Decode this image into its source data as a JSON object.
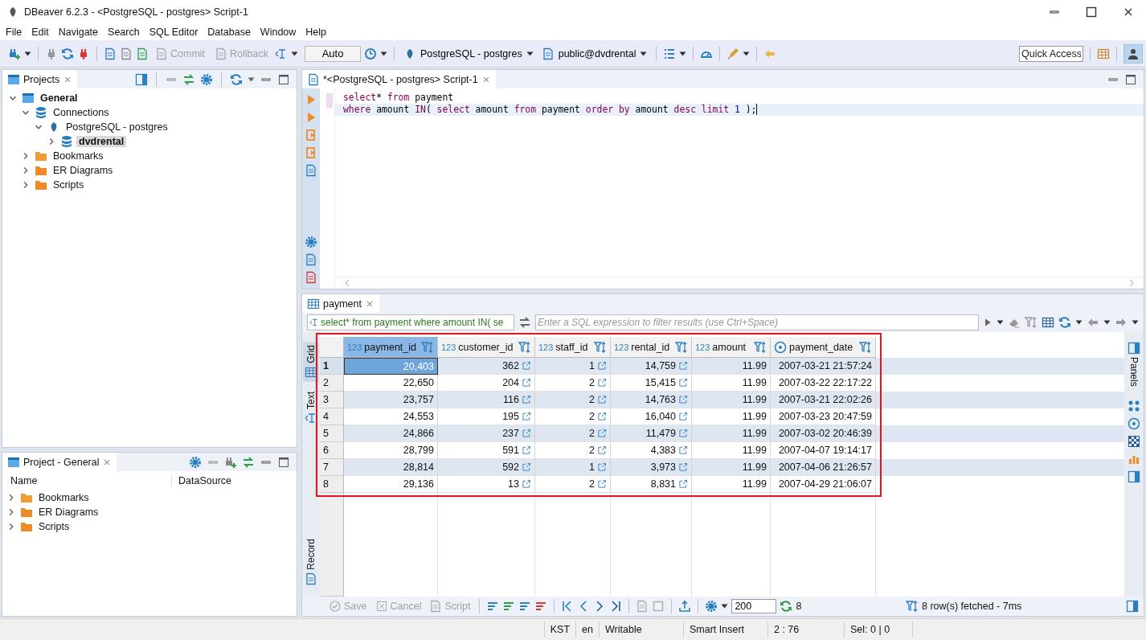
{
  "window": {
    "title": "DBeaver 6.2.3 - <PostgreSQL - postgres> Script-1"
  },
  "menu": [
    "File",
    "Edit",
    "Navigate",
    "Search",
    "SQL Editor",
    "Database",
    "Window",
    "Help"
  ],
  "toolbar": {
    "commit": {
      "label": "Commit",
      "disabled": true
    },
    "rollback": {
      "label": "Rollback",
      "disabled": true
    },
    "transaction_mode": "Auto",
    "connection": "PostgreSQL - postgres",
    "schema": "public@dvdrental",
    "quick_access": {
      "placeholder": "Quick Access"
    }
  },
  "projects": {
    "title": "Projects",
    "tree": [
      {
        "label": "General",
        "kind": "project",
        "bold": true,
        "expanded": true,
        "selected": false,
        "children": [
          {
            "label": "Connections",
            "kind": "connections",
            "bold": false,
            "expanded": true,
            "selected": false,
            "children": [
              {
                "label": "PostgreSQL - postgres",
                "kind": "connection",
                "bold": false,
                "expanded": true,
                "selected": false,
                "children": [
                  {
                    "label": "dvdrental",
                    "kind": "database",
                    "bold": true,
                    "expanded": false,
                    "selected": true
                  }
                ]
              }
            ]
          },
          {
            "label": "Bookmarks",
            "kind": "bookmarks",
            "bold": false,
            "expanded": false,
            "selected": false
          },
          {
            "label": "ER Diagrams",
            "kind": "diagrams",
            "bold": false,
            "expanded": false,
            "selected": false
          },
          {
            "label": "Scripts",
            "kind": "scripts",
            "bold": false,
            "expanded": false,
            "selected": false
          }
        ]
      }
    ]
  },
  "project_general": {
    "title": "Project - General",
    "columns": [
      "Name",
      "DataSource"
    ],
    "items": [
      {
        "label": "Bookmarks",
        "kind": "bookmarks",
        "expanded": false
      },
      {
        "label": "ER Diagrams",
        "kind": "diagrams",
        "expanded": false
      },
      {
        "label": "Scripts",
        "kind": "scripts",
        "expanded": false
      }
    ]
  },
  "editor": {
    "tab": {
      "label": "*<PostgreSQL - postgres> Script-1",
      "selected": true
    },
    "lines": [
      {
        "current": false,
        "tokens": [
          {
            "text": "select",
            "kind": "keyword"
          },
          {
            "text": "* ",
            "kind": "plain"
          },
          {
            "text": "from",
            "kind": "keyword"
          },
          {
            "text": " payment",
            "kind": "plain"
          }
        ]
      },
      {
        "current": true,
        "tokens": [
          {
            "text": "where",
            "kind": "keyword"
          },
          {
            "text": " amount ",
            "kind": "plain"
          },
          {
            "text": "IN",
            "kind": "keyword"
          },
          {
            "text": "( ",
            "kind": "plain"
          },
          {
            "text": "select",
            "kind": "keyword"
          },
          {
            "text": " amount ",
            "kind": "plain"
          },
          {
            "text": "from",
            "kind": "keyword"
          },
          {
            "text": " payment ",
            "kind": "plain"
          },
          {
            "text": "order by",
            "kind": "keyword"
          },
          {
            "text": " amount ",
            "kind": "plain"
          },
          {
            "text": "desc limit",
            "kind": "keyword"
          },
          {
            "text": " 1",
            "kind": "number"
          },
          {
            "text": " );",
            "kind": "plain"
          }
        ]
      }
    ]
  },
  "results": {
    "tab": {
      "label": "payment",
      "selected": true
    },
    "query": "select* from payment where amount IN( se",
    "filter": {
      "placeholder": "Enter a SQL expression to filter results (use Ctrl+Space)"
    },
    "views": [
      {
        "label": "Grid",
        "selected": true
      },
      {
        "label": "Text",
        "selected": false
      },
      {
        "label": "Record",
        "selected": false
      }
    ],
    "panels": {
      "label": "Panels"
    },
    "highlighted": true,
    "columns": [
      {
        "name": "payment_id",
        "kind": "numeric",
        "type_label": "123",
        "selected": true,
        "link": false
      },
      {
        "name": "customer_id",
        "kind": "numeric",
        "type_label": "123",
        "selected": false,
        "link": true
      },
      {
        "name": "staff_id",
        "kind": "numeric",
        "type_label": "123",
        "selected": false,
        "link": true
      },
      {
        "name": "rental_id",
        "kind": "numeric",
        "type_label": "123",
        "selected": false,
        "link": true
      },
      {
        "name": "amount",
        "kind": "numeric",
        "type_label": "123",
        "selected": false,
        "link": false
      },
      {
        "name": "payment_date",
        "kind": "datetime",
        "selected": false,
        "link": false
      }
    ],
    "rows": [
      {
        "number": "1",
        "selected": true,
        "cells": [
          "20,403",
          "362",
          "1",
          "14,759",
          "11.99",
          "2007-03-21 21:57:24"
        ]
      },
      {
        "number": "2",
        "selected": false,
        "cells": [
          "22,650",
          "204",
          "2",
          "15,415",
          "11.99",
          "2007-03-22 22:17:22"
        ]
      },
      {
        "number": "3",
        "selected": false,
        "cells": [
          "23,757",
          "116",
          "2",
          "14,763",
          "11.99",
          "2007-03-21 22:02:26"
        ]
      },
      {
        "number": "4",
        "selected": false,
        "cells": [
          "24,553",
          "195",
          "2",
          "16,040",
          "11.99",
          "2007-03-23 20:47:59"
        ]
      },
      {
        "number": "5",
        "selected": false,
        "cells": [
          "24,866",
          "237",
          "2",
          "11,479",
          "11.99",
          "2007-03-02 20:46:39"
        ]
      },
      {
        "number": "6",
        "selected": false,
        "cells": [
          "28,799",
          "591",
          "2",
          "4,383",
          "11.99",
          "2007-04-07 19:14:17"
        ]
      },
      {
        "number": "7",
        "selected": false,
        "cells": [
          "28,814",
          "592",
          "1",
          "3,973",
          "11.99",
          "2007-04-06 21:26:57"
        ]
      },
      {
        "number": "8",
        "selected": false,
        "cells": [
          "29,136",
          "13",
          "2",
          "8,831",
          "11.99",
          "2007-04-29 21:06:07"
        ]
      }
    ],
    "footer": {
      "save": {
        "label": "Save",
        "disabled": true
      },
      "cancel": {
        "label": "Cancel",
        "disabled": true
      },
      "script": {
        "label": "Script",
        "disabled": true
      },
      "fetch_size": "200",
      "row_count": "8",
      "status": "8 row(s) fetched - 7ms"
    }
  },
  "status_bar": [
    "KST",
    "en",
    "Writable",
    "Smart Insert",
    "2 : 76",
    "Sel: 0 | 0"
  ]
}
